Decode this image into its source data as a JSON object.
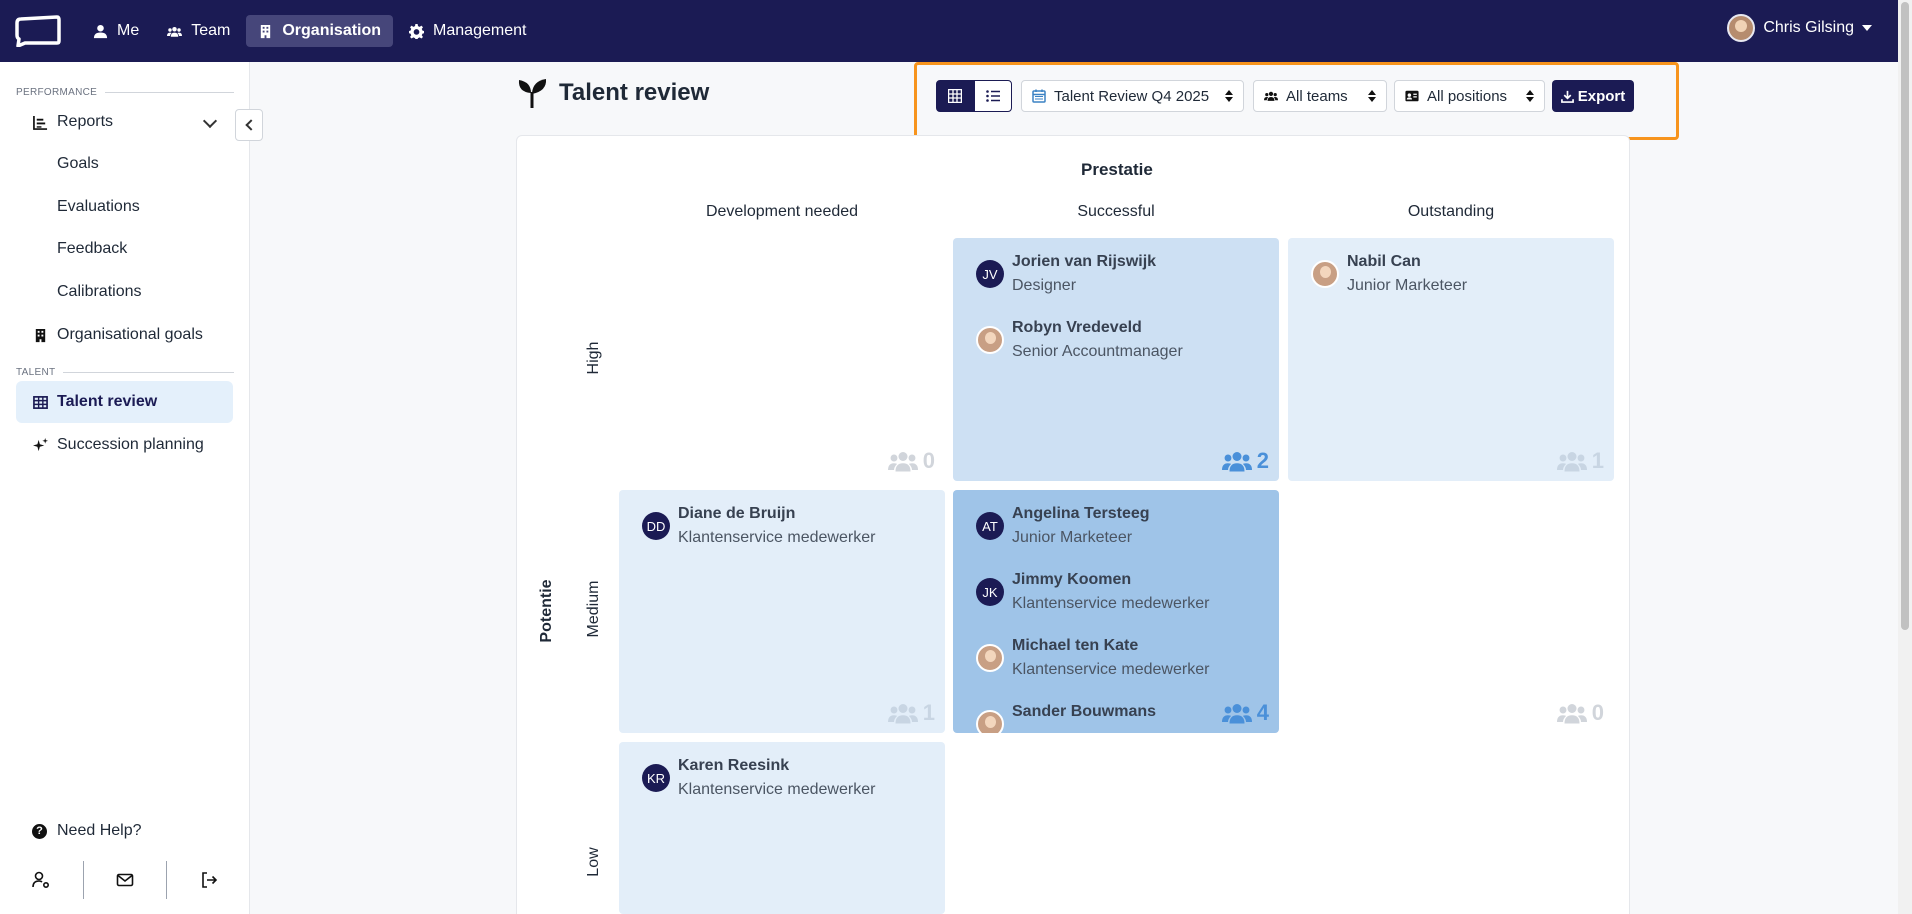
{
  "nav": {
    "items": [
      {
        "label": "Me"
      },
      {
        "label": "Team"
      },
      {
        "label": "Organisation"
      },
      {
        "label": "Management"
      }
    ],
    "user_name": "Chris Gilsing"
  },
  "sidebar": {
    "section_performance": "PERFORMANCE",
    "reports": "Reports",
    "goals": "Goals",
    "evaluations": "Evaluations",
    "feedback": "Feedback",
    "calibrations": "Calibrations",
    "organisational_goals": "Organisational goals",
    "section_talent": "TALENT",
    "talent_review": "Talent review",
    "succession_planning": "Succession planning",
    "help": "Need Help?"
  },
  "header": {
    "title": "Talent review",
    "review_select": "Talent Review Q4 2025",
    "teams_select": "All teams",
    "positions_select": "All positions",
    "export_label": "Export"
  },
  "grid": {
    "x_axis": "Prestatie",
    "y_axis": "Potentie",
    "columns": [
      "Development needed",
      "Successful",
      "Outstanding"
    ],
    "rows": [
      "High",
      "Medium",
      "Low"
    ],
    "cells": {
      "high_dev": {
        "count": "0",
        "people": []
      },
      "high_succ": {
        "count": "2",
        "people": [
          {
            "initials": "JV",
            "name": "Jorien van Rijswijk",
            "role": "Designer"
          },
          {
            "initials": "",
            "name": "Robyn Vredeveld",
            "role": "Senior Accountmanager"
          }
        ]
      },
      "high_out": {
        "count": "1",
        "people": [
          {
            "initials": "",
            "name": "Nabil Can",
            "role": "Junior Marketeer"
          }
        ]
      },
      "med_dev": {
        "count": "1",
        "people": [
          {
            "initials": "DD",
            "name": "Diane de Bruijn",
            "role": "Klantenservice medewerker"
          }
        ]
      },
      "med_succ": {
        "count": "4",
        "people": [
          {
            "initials": "AT",
            "name": "Angelina Tersteeg",
            "role": "Junior Marketeer"
          },
          {
            "initials": "JK",
            "name": "Jimmy Koomen",
            "role": "Klantenservice medewerker"
          },
          {
            "initials": "",
            "name": "Michael ten Kate",
            "role": "Klantenservice medewerker"
          },
          {
            "initials": "",
            "name": "Sander Bouwmans",
            "role": ""
          }
        ]
      },
      "med_out": {
        "count": "0",
        "people": []
      },
      "low_dev": {
        "count": "",
        "people": [
          {
            "initials": "KR",
            "name": "Karen Reesink",
            "role": "Klantenservice medewerker"
          }
        ]
      }
    }
  }
}
